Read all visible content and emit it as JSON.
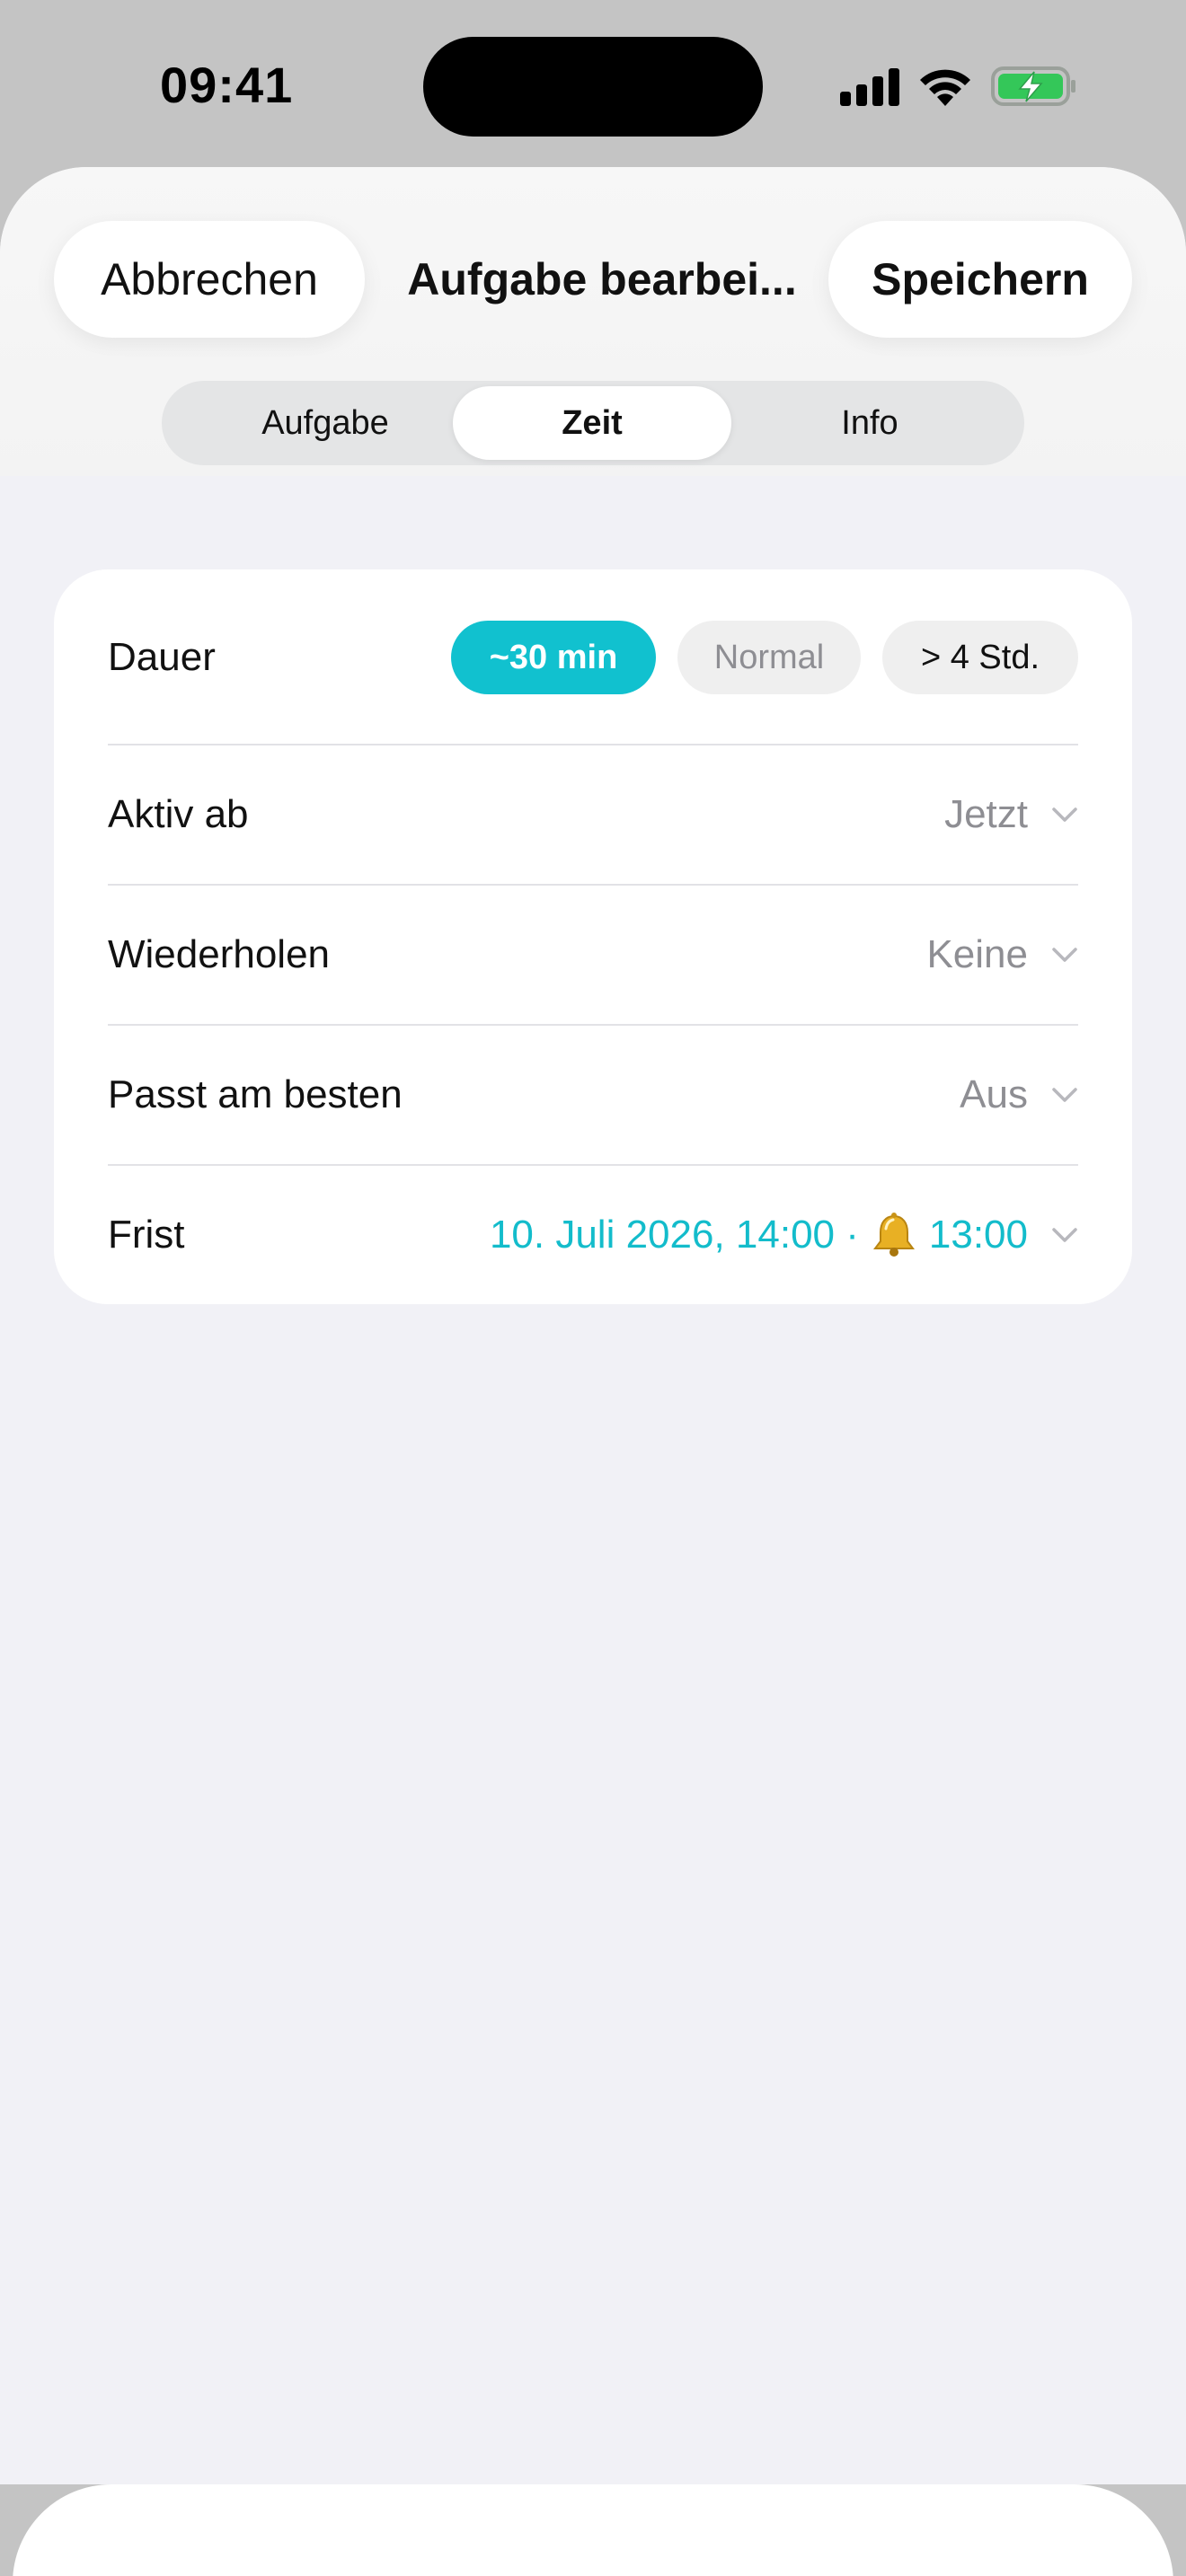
{
  "status_bar": {
    "time": "09:41",
    "icons": [
      "signal-icon",
      "wifi-icon",
      "battery-charging-icon"
    ]
  },
  "header": {
    "cancel_label": "Abbrechen",
    "title": "Aufgabe bearbei...",
    "save_label": "Speichern"
  },
  "tabs": [
    {
      "label": "Aufgabe",
      "selected": false
    },
    {
      "label": "Zeit",
      "selected": true
    },
    {
      "label": "Info",
      "selected": false
    }
  ],
  "settings": {
    "duration": {
      "label": "Dauer",
      "options": [
        {
          "label": "~30 min",
          "selected": true
        },
        {
          "label": "Normal",
          "selected": false
        },
        {
          "label": "> 4 Std.",
          "selected": false
        }
      ]
    },
    "active_from": {
      "label": "Aktiv ab",
      "value": "Jetzt"
    },
    "repeat": {
      "label": "Wiederholen",
      "value": "Keine"
    },
    "best_fit": {
      "label": "Passt am besten",
      "value": "Aus"
    },
    "deadline": {
      "label": "Frist",
      "date": "10. Juli 2026, 14:00 ·",
      "reminder": "13:00"
    }
  },
  "colors": {
    "accent": "#11c1cf",
    "sheet_background": "#f1f1f6",
    "screen_background": "#c4c4c4",
    "battery_charging": "#34c759"
  }
}
